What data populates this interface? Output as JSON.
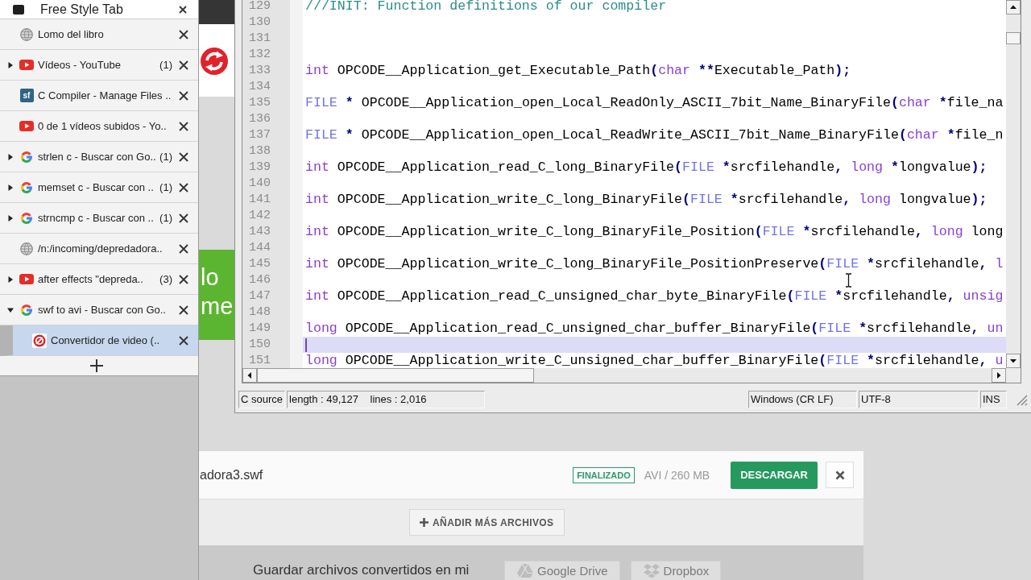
{
  "sidebar": {
    "title": "Free Style Tab",
    "tabs": [
      {
        "title": "Lomo del libro",
        "kind": "globe",
        "selected": false
      },
      {
        "title": "Vídeos - YouTube",
        "kind": "video",
        "count": "(1)",
        "expanded": false,
        "selected": false
      },
      {
        "title": "C Compiler - Manage Files ..",
        "kind": "tile",
        "favicon_label": "sf",
        "selected": false
      },
      {
        "title": "0 de 1 vídeos subidos - Yo..",
        "kind": "video",
        "selected": false
      },
      {
        "title": "strlen c - Buscar con Go..",
        "kind": "g",
        "count": "(1)",
        "expanded": false,
        "selected": false
      },
      {
        "title": "memset c - Buscar con ..",
        "kind": "g",
        "count": "(1)",
        "expanded": false,
        "selected": false
      },
      {
        "title": "strncmp c - Buscar con ..",
        "kind": "g",
        "count": "(1)",
        "expanded": false,
        "selected": false
      },
      {
        "title": "/n:/incoming/depredadora..",
        "kind": "globe",
        "selected": false
      },
      {
        "title": "after effects \"depreda..",
        "kind": "video",
        "count": "(3)",
        "expanded": false,
        "selected": false
      },
      {
        "title": "swf to avi - Buscar con Go..",
        "kind": "g",
        "expanded": true,
        "selected": false,
        "children": [
          {
            "title": "Convertidor de video (..",
            "kind": "converter",
            "selected": true
          }
        ]
      }
    ]
  },
  "web_page": {
    "banner_lines": [
      "lo",
      "me"
    ],
    "file": {
      "name": "adora3.swf",
      "status": "FINALIZADO",
      "info": "AVI / 260 MB",
      "download": "DESCARGAR"
    },
    "add_more": "AÑADIR MÁS ARCHIVOS",
    "save_prompt": "Guardar archivos convertidos en mi",
    "cloud_buttons": [
      {
        "label": "Google Drive",
        "kind": "drive"
      },
      {
        "label": "Dropbox",
        "kind": "dropbox"
      }
    ]
  },
  "editor": {
    "lines": [
      {
        "number": "129",
        "current": false,
        "tokens": [
          {
            "kind": "comment",
            "text": "///INIT: Function definitions of our compiler"
          }
        ]
      },
      {
        "number": "130",
        "current": false
      },
      {
        "number": "131",
        "current": false
      },
      {
        "number": "132",
        "current": false
      },
      {
        "number": "133",
        "current": false,
        "tokens": [
          {
            "kind": "keyword",
            "text": "int"
          },
          {
            "kind": "plain",
            "text": " OPCODE__Application_get_Executable_Path"
          },
          {
            "kind": "operator",
            "text": "("
          },
          {
            "kind": "keyword",
            "text": "char"
          },
          {
            "kind": "operator",
            "text": " **"
          },
          {
            "kind": "plain",
            "text": "Executable_Path"
          },
          {
            "kind": "operator",
            "text": ");"
          }
        ]
      },
      {
        "number": "134",
        "current": false
      },
      {
        "number": "135",
        "current": false,
        "tokens": [
          {
            "kind": "type",
            "text": "FILE"
          },
          {
            "kind": "operator",
            "text": " *"
          },
          {
            "kind": "plain",
            "text": " OPCODE__Application_open_Local_ReadOnly_ASCII_7bit_Name_BinaryFile"
          },
          {
            "kind": "operator",
            "text": "("
          },
          {
            "kind": "keyword",
            "text": "char"
          },
          {
            "kind": "operator",
            "text": " *"
          },
          {
            "kind": "plain",
            "text": "file_na"
          }
        ]
      },
      {
        "number": "136",
        "current": false
      },
      {
        "number": "137",
        "current": false,
        "tokens": [
          {
            "kind": "type",
            "text": "FILE"
          },
          {
            "kind": "operator",
            "text": " *"
          },
          {
            "kind": "plain",
            "text": " OPCODE__Application_open_Local_ReadWrite_ASCII_7bit_Name_BinaryFile"
          },
          {
            "kind": "operator",
            "text": "("
          },
          {
            "kind": "keyword",
            "text": "char"
          },
          {
            "kind": "operator",
            "text": " *"
          },
          {
            "kind": "plain",
            "text": "file_n"
          }
        ]
      },
      {
        "number": "138",
        "current": false
      },
      {
        "number": "139",
        "current": false,
        "tokens": [
          {
            "kind": "keyword",
            "text": "int"
          },
          {
            "kind": "plain",
            "text": " OPCODE__Application_read_C_long_BinaryFile"
          },
          {
            "kind": "operator",
            "text": "("
          },
          {
            "kind": "type",
            "text": "FILE"
          },
          {
            "kind": "operator",
            "text": " *"
          },
          {
            "kind": "plain",
            "text": "srcfilehandle"
          },
          {
            "kind": "operator",
            "text": ","
          },
          {
            "kind": "keyword",
            "text": " long"
          },
          {
            "kind": "operator",
            "text": " *"
          },
          {
            "kind": "plain",
            "text": "longvalue"
          },
          {
            "kind": "operator",
            "text": ");"
          }
        ]
      },
      {
        "number": "140",
        "current": false
      },
      {
        "number": "141",
        "current": false,
        "tokens": [
          {
            "kind": "keyword",
            "text": "int"
          },
          {
            "kind": "plain",
            "text": " OPCODE__Application_write_C_long_BinaryFile"
          },
          {
            "kind": "operator",
            "text": "("
          },
          {
            "kind": "type",
            "text": "FILE"
          },
          {
            "kind": "operator",
            "text": " *"
          },
          {
            "kind": "plain",
            "text": "srcfilehandle"
          },
          {
            "kind": "operator",
            "text": ","
          },
          {
            "kind": "keyword",
            "text": " long"
          },
          {
            "kind": "plain",
            "text": " longvalue"
          },
          {
            "kind": "operator",
            "text": ");"
          }
        ]
      },
      {
        "number": "142",
        "current": false
      },
      {
        "number": "143",
        "current": false,
        "tokens": [
          {
            "kind": "keyword",
            "text": "int"
          },
          {
            "kind": "plain",
            "text": " OPCODE__Application_write_C_long_BinaryFile_Position"
          },
          {
            "kind": "operator",
            "text": "("
          },
          {
            "kind": "type",
            "text": "FILE"
          },
          {
            "kind": "operator",
            "text": " *"
          },
          {
            "kind": "plain",
            "text": "srcfilehandle"
          },
          {
            "kind": "operator",
            "text": ","
          },
          {
            "kind": "keyword",
            "text": " long"
          },
          {
            "kind": "plain",
            "text": " long"
          }
        ]
      },
      {
        "number": "144",
        "current": false
      },
      {
        "number": "145",
        "current": false,
        "tokens": [
          {
            "kind": "keyword",
            "text": "int"
          },
          {
            "kind": "plain",
            "text": " OPCODE__Application_write_C_long_BinaryFile_PositionPreserve"
          },
          {
            "kind": "operator",
            "text": "("
          },
          {
            "kind": "type",
            "text": "FILE"
          },
          {
            "kind": "operator",
            "text": " *"
          },
          {
            "kind": "plain",
            "text": "srcfilehandle"
          },
          {
            "kind": "operator",
            "text": ","
          },
          {
            "kind": "keyword",
            "text": " l"
          }
        ]
      },
      {
        "number": "146",
        "current": false
      },
      {
        "number": "147",
        "current": false,
        "tokens": [
          {
            "kind": "keyword",
            "text": "int"
          },
          {
            "kind": "plain",
            "text": " OPCODE__Application_read_C_unsigned_char_byte_BinaryFile"
          },
          {
            "kind": "operator",
            "text": "("
          },
          {
            "kind": "type",
            "text": "FILE"
          },
          {
            "kind": "operator",
            "text": " *"
          },
          {
            "kind": "plain",
            "text": "srcfilehandle"
          },
          {
            "kind": "operator",
            "text": ","
          },
          {
            "kind": "keyword",
            "text": " unsig"
          }
        ]
      },
      {
        "number": "148",
        "current": false
      },
      {
        "number": "149",
        "current": false,
        "tokens": [
          {
            "kind": "keyword",
            "text": "long"
          },
          {
            "kind": "plain",
            "text": " OPCODE__Application_read_C_unsigned_char_buffer_BinaryFile"
          },
          {
            "kind": "operator",
            "text": "("
          },
          {
            "kind": "type",
            "text": "FILE"
          },
          {
            "kind": "operator",
            "text": " *"
          },
          {
            "kind": "plain",
            "text": "srcfilehandle"
          },
          {
            "kind": "operator",
            "text": ","
          },
          {
            "kind": "keyword",
            "text": " un"
          }
        ]
      },
      {
        "number": "150",
        "current": true
      },
      {
        "number": "151",
        "current": false,
        "tokens": [
          {
            "kind": "keyword",
            "text": "long"
          },
          {
            "kind": "plain",
            "text": " OPCODE__Application_write_C_unsigned_char_buffer_BinaryFile"
          },
          {
            "kind": "operator",
            "text": "("
          },
          {
            "kind": "type",
            "text": "FILE"
          },
          {
            "kind": "operator",
            "text": " *"
          },
          {
            "kind": "plain",
            "text": "srcfilehandle"
          },
          {
            "kind": "operator",
            "text": ","
          },
          {
            "kind": "keyword",
            "text": " u"
          }
        ]
      }
    ],
    "status_bar": {
      "language": "C source",
      "stats": "length : 49,127    lines : 2,016",
      "line_endings": "Windows (CR LF)",
      "encoding": "UTF-8",
      "mode": "INS"
    }
  }
}
